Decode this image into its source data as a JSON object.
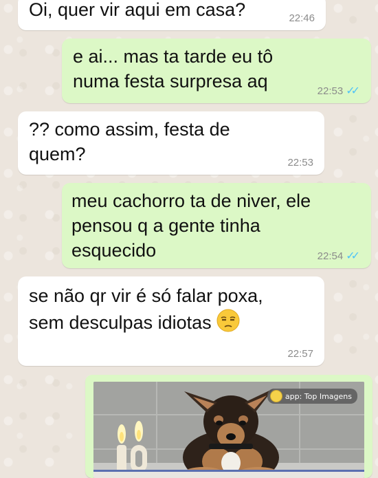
{
  "messages": [
    {
      "direction": "incoming",
      "text": "Oi, quer vir aqui em casa?",
      "time": "22:46"
    },
    {
      "direction": "outgoing",
      "text": "e ai... mas ta tarde eu tô\nnuma festa surpresa aq",
      "time": "22:53",
      "status": "read"
    },
    {
      "direction": "incoming",
      "text": "?? como assim, festa de\nquem?",
      "time": "22:53"
    },
    {
      "direction": "outgoing",
      "text": "meu cachorro ta de niver, ele\npensou q a gente tinha\nesquecido",
      "time": "22:54",
      "status": "read"
    },
    {
      "direction": "incoming",
      "text": "se não qr vir é só falar poxa,\nsem desculpas idiotas",
      "time": "22:57",
      "emoji": "unamused-face"
    }
  ],
  "photo": {
    "watermark": "app: Top Imagens",
    "cake_number": "10",
    "subject": "dog-with-birthday-cake"
  },
  "colors": {
    "background": "#ece5dd",
    "incoming_bubble": "#ffffff",
    "outgoing_bubble": "#dcf8c6",
    "read_ticks": "#4fc3f7",
    "timestamp": "#8b8b8b"
  }
}
